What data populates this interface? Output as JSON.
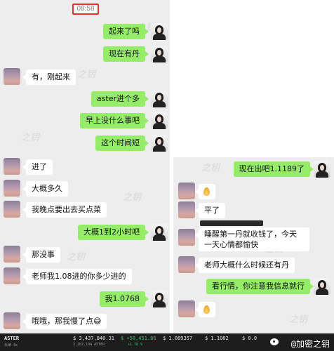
{
  "left": {
    "timestamp": "08:58",
    "messages": [
      {
        "dir": "out",
        "text": "起来了吗"
      },
      {
        "dir": "out",
        "text": "现在有丹"
      },
      {
        "dir": "in",
        "text": "有，刚起来"
      },
      {
        "dir": "out",
        "text": "aster进个多"
      },
      {
        "dir": "out",
        "text": "早上没什么事吧"
      },
      {
        "dir": "out",
        "text": "这个时间短"
      },
      {
        "dir": "in",
        "text": "进了"
      },
      {
        "dir": "in",
        "text": "大概多久"
      },
      {
        "dir": "in",
        "text": "我晚点要出去买点菜"
      },
      {
        "dir": "out",
        "text": "大概1到2小时吧"
      },
      {
        "dir": "in",
        "text": "那没事"
      },
      {
        "dir": "in",
        "text": "老师我1.08进的你多少进的"
      },
      {
        "dir": "out",
        "text": "我1.0768"
      },
      {
        "dir": "in",
        "text": "哦哦，那我慢了点😅"
      }
    ]
  },
  "right": {
    "messages": [
      {
        "dir": "out",
        "text": "现在出吧1.1189了"
      },
      {
        "dir": "in",
        "text": "👌"
      },
      {
        "dir": "in",
        "text": "平了"
      },
      {
        "dir": "in",
        "text": "睡醒第一丹就收钱了，今天一天心情都愉快"
      },
      {
        "dir": "in",
        "text": "老师大概什么时候还有丹"
      },
      {
        "dir": "out",
        "text": "看行情，你注意我信息就行"
      },
      {
        "dir": "in",
        "text": "👌"
      }
    ]
  },
  "watermark": "之钥",
  "ticker": {
    "symbol": "ASTER",
    "symbol_sub": "永续 3x",
    "v1": "$ 3,437,840.31",
    "v1_sub": "3,102,194 ASTER",
    "v2": "$ +58,451.86",
    "v2_sub": "+1.78 %",
    "v3": "$ 1.089357",
    "v4": "$ 1.1082",
    "v5": "$ 0.0"
  },
  "credit": "@加密之钥",
  "colors": {
    "sent_bubble": "#95ec69",
    "received_bubble": "#ffffff",
    "chat_background": "#ededed",
    "highlight_border": "#e0342f",
    "ticker_positive": "#3fbf74"
  }
}
